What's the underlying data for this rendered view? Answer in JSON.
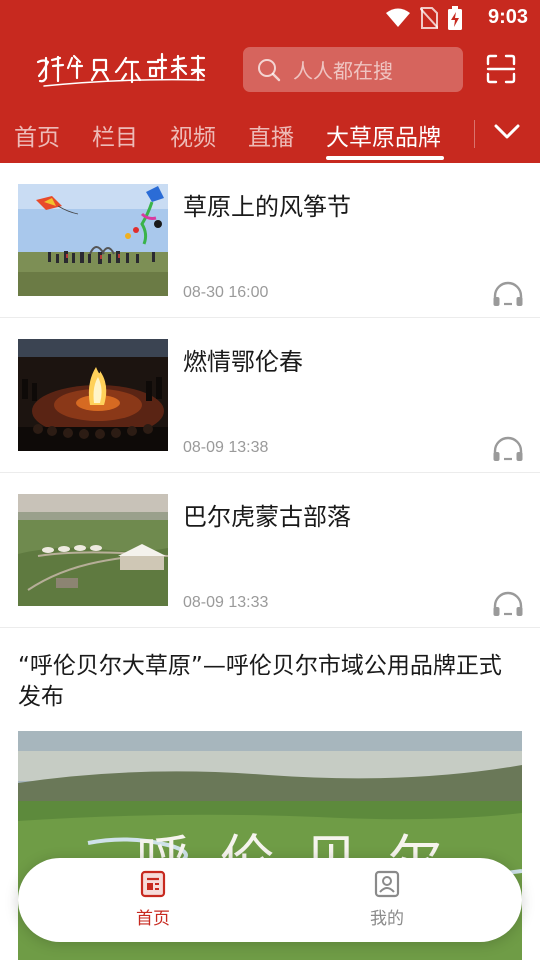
{
  "status_bar": {
    "time": "9:03"
  },
  "header": {
    "logo_text": "呼伦贝尔融媒",
    "search_placeholder": "人人都在搜"
  },
  "tabs": [
    {
      "label": "首页",
      "active": false
    },
    {
      "label": "栏目",
      "active": false
    },
    {
      "label": "视频",
      "active": false
    },
    {
      "label": "直播",
      "active": false
    },
    {
      "label": "大草原品牌",
      "active": true
    }
  ],
  "articles": [
    {
      "title": "草原上的风筝节",
      "time": "08-30 16:00"
    },
    {
      "title": "燃情鄂伦春",
      "time": "08-09 13:38"
    },
    {
      "title": "巴尔虎蒙古部落",
      "time": "08-09 13:33"
    }
  ],
  "feature": {
    "title": "“呼伦贝尔大草原”—呼伦贝尔市域公用品牌正式发布",
    "image_overlay_text": "呼伦贝尔"
  },
  "bottom_nav": [
    {
      "label": "首页",
      "active": true
    },
    {
      "label": "我的",
      "active": false
    }
  ],
  "colors": {
    "brand_red": "#c7291f",
    "active_nav": "#c7291f",
    "inactive_nav": "#8a8a8a"
  }
}
